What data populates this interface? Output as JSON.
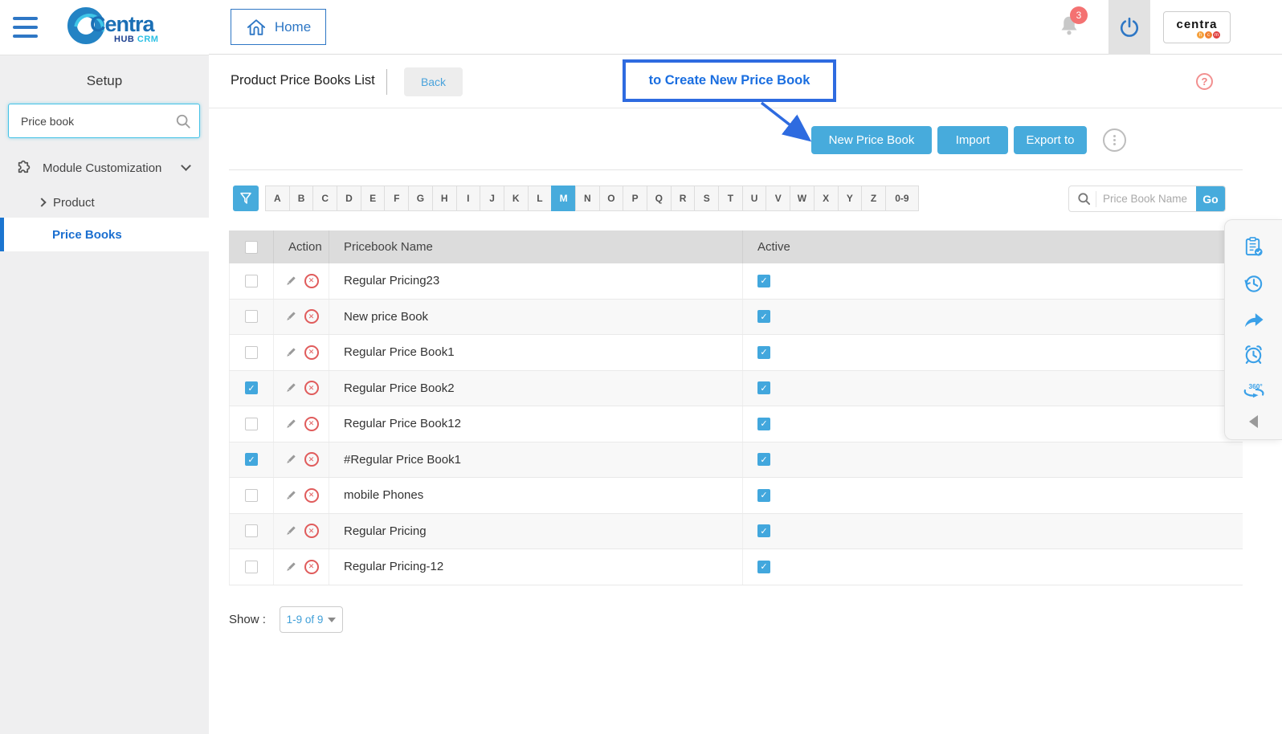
{
  "app": {
    "logo_primary": "Centra",
    "logo_hub": "HUB",
    "logo_crm": "CRM",
    "mini_logo_word": "centra",
    "mini_logo_dots": [
      {
        "letter": "h",
        "color": "#f5a03c"
      },
      {
        "letter": "c",
        "color": "#f08030"
      },
      {
        "letter": "m",
        "color": "#e04040"
      }
    ],
    "notification_count": "3"
  },
  "topbar": {
    "home_label": "Home"
  },
  "sidebar": {
    "title": "Setup",
    "search_value": "Price book",
    "items": [
      {
        "label": "Module Customization"
      },
      {
        "label": "Product"
      },
      {
        "label": "Price Books"
      }
    ]
  },
  "page": {
    "title": "Product Price Books List",
    "back_label": "Back",
    "callout": "to Create New Price Book",
    "help_label": "?",
    "buttons": {
      "new": "New Price Book",
      "import": "Import",
      "export": "Export to"
    }
  },
  "filter": {
    "letters": [
      "A",
      "B",
      "C",
      "D",
      "E",
      "F",
      "G",
      "H",
      "I",
      "J",
      "K",
      "L",
      "M",
      "N",
      "O",
      "P",
      "Q",
      "R",
      "S",
      "T",
      "U",
      "V",
      "W",
      "X",
      "Y",
      "Z",
      "0-9"
    ],
    "active_letter": "M",
    "search_placeholder": "Price Book Name",
    "go_label": "Go"
  },
  "table": {
    "headers": {
      "action": "Action",
      "name": "Pricebook Name",
      "active": "Active"
    },
    "rows": [
      {
        "name": "Regular Pricing23",
        "selected": false,
        "active": true
      },
      {
        "name": "New price Book",
        "selected": false,
        "active": true
      },
      {
        "name": "Regular Price Book1",
        "selected": false,
        "active": true
      },
      {
        "name": "Regular Price Book2",
        "selected": true,
        "active": true
      },
      {
        "name": "Regular Price Book12",
        "selected": false,
        "active": true
      },
      {
        "name": "#Regular Price Book1",
        "selected": true,
        "active": true
      },
      {
        "name": "mobile Phones",
        "selected": false,
        "active": true
      },
      {
        "name": "Regular Pricing",
        "selected": false,
        "active": true
      },
      {
        "name": "Regular Pricing-12",
        "selected": false,
        "active": true
      }
    ]
  },
  "footer": {
    "show_label": "Show :",
    "range": "1-9 of 9"
  },
  "colors": {
    "accent_blue": "#2e77c5",
    "button_blue": "#47abdc",
    "callout_blue": "#2e6be0",
    "active_check": "#42a7dd",
    "delete_red": "#e05c5c",
    "badge_red": "#f47272",
    "sidebar_active": "#1b75d0"
  }
}
